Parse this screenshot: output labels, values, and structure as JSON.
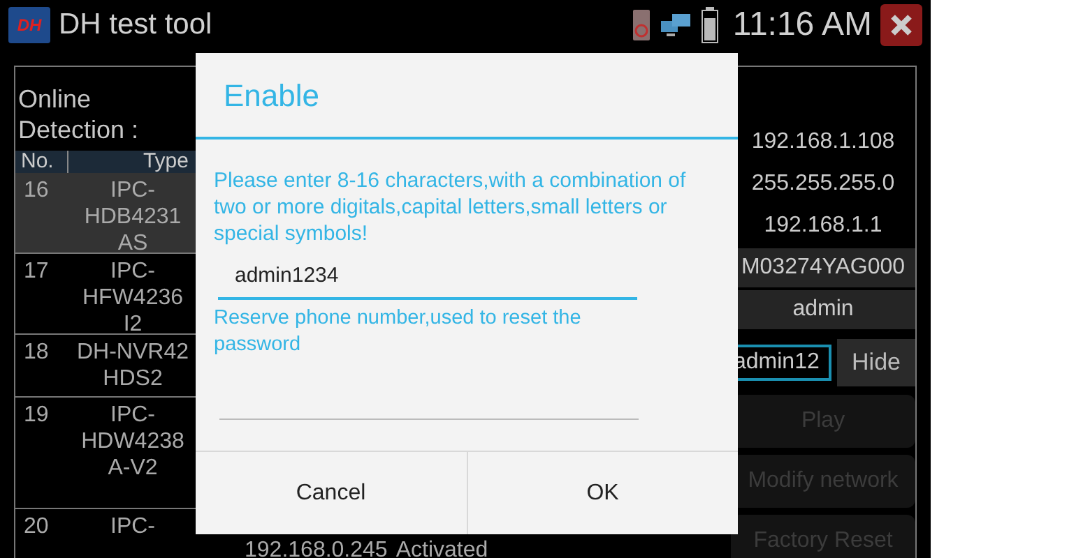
{
  "status_bar": {
    "app_logo": "DH",
    "title": "DH test tool",
    "time": "11:16 AM"
  },
  "panel": {
    "heading": "Online Detection :",
    "columns": [
      "No.",
      "Type"
    ],
    "rows": [
      {
        "no": "16",
        "type": [
          "IPC-",
          "HDB4231",
          "AS"
        ],
        "selected": true
      },
      {
        "no": "17",
        "type": [
          "IPC-",
          "HFW4236",
          "I2"
        ],
        "selected": false
      },
      {
        "no": "18",
        "type": [
          "DH-NVR42",
          "HDS2"
        ],
        "selected": false
      },
      {
        "no": "19",
        "type": [
          "IPC-",
          "HDW4238",
          "A-V2"
        ],
        "selected": false
      },
      {
        "no": "20",
        "type": [
          "IPC-"
        ],
        "ip": "192.168.0.245",
        "status": "Activated",
        "selected": false
      }
    ]
  },
  "details": {
    "values": [
      {
        "text": "192.168.1.108",
        "shaded": false
      },
      {
        "text": "255.255.255.0",
        "shaded": false
      },
      {
        "text": "192.168.1.1",
        "shaded": false
      },
      {
        "text": "M03274YAG000",
        "shaded": true
      },
      {
        "text": "admin",
        "shaded": true
      }
    ],
    "password": "admin12",
    "hide_button": "Hide",
    "buttons": [
      {
        "label": "Play",
        "disabled": true
      },
      {
        "label": "Modify network",
        "disabled": true
      },
      {
        "label": "Factory Reset",
        "disabled": true
      }
    ]
  },
  "dialog": {
    "title": "Enable",
    "message": "Please enter 8-16 characters,with a combination of two or more digitals,capital letters,small letters or special symbols!",
    "password": "admin1234",
    "phone_hint": "Reserve phone number,used to reset the password",
    "buttons": [
      "Cancel",
      "OK"
    ]
  }
}
